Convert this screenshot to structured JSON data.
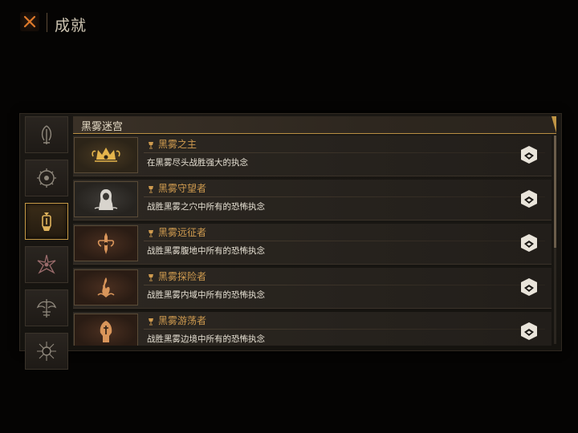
{
  "header": {
    "title": "成就",
    "close_icon": "close-icon"
  },
  "sidebar": {
    "tabs": [
      {
        "icon": "crescent-flame-icon",
        "active": false
      },
      {
        "icon": "eye-gear-icon",
        "active": false
      },
      {
        "icon": "lantern-icon",
        "active": true
      },
      {
        "icon": "thorn-star-icon",
        "active": false
      },
      {
        "icon": "winged-figure-icon",
        "active": false
      },
      {
        "icon": "spiked-eye-icon",
        "active": false
      }
    ]
  },
  "section": {
    "title": "黑雾迷宫"
  },
  "achievements": [
    {
      "name": "黑雾之主",
      "desc": "在黑雾尽头战胜强大的执念",
      "tier": "gold",
      "icon": "crown-crest-icon"
    },
    {
      "name": "黑雾守望者",
      "desc": "战胜黑雾之穴中所有的恐怖执念",
      "tier": "grey",
      "icon": "hooded-figure-icon"
    },
    {
      "name": "黑雾远征者",
      "desc": "战胜黑雾腹地中所有的恐怖执念",
      "tier": "copper",
      "icon": "sword-rune-icon"
    },
    {
      "name": "黑雾探险者",
      "desc": "战胜黑雾内域中所有的恐怖执念",
      "tier": "copper",
      "icon": "flame-rune-icon"
    },
    {
      "name": "黑雾游荡者",
      "desc": "战胜黑雾边境中所有的恐怖执念",
      "tier": "copper",
      "icon": "helm-rune-icon"
    }
  ],
  "colors": {
    "accent_gold": "#c69a46",
    "name_text": "#cf9b4f",
    "background": "#050403"
  }
}
